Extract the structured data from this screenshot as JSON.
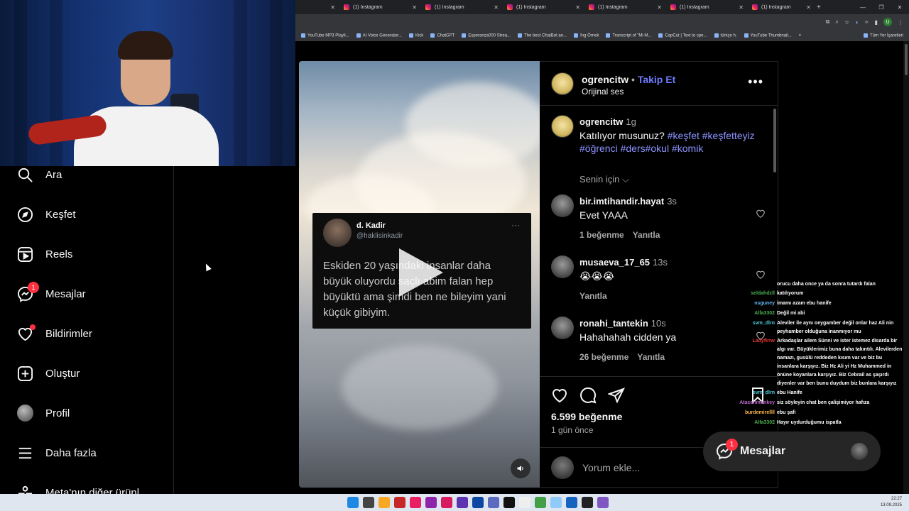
{
  "browser": {
    "tabs": [
      {
        "label": "(1) Instagram"
      },
      {
        "label": "(1) Instagram"
      },
      {
        "label": "(1) Instagram"
      },
      {
        "label": "(1) Instagram"
      },
      {
        "label": "(1) Instagram"
      },
      {
        "label": "(1) Instagram"
      }
    ],
    "bookmarks": [
      "YouTube MP3 Playli...",
      "AI Voice Generator...",
      "Kick",
      "ChatGPT",
      "Esperanza000 Strea...",
      "The best ChatBot an...",
      "İng Örnek",
      "Transcript of \"Mi M...",
      "CapCut | Text to spe...",
      "türkçe h.",
      "YouTube Thumbnail..."
    ],
    "all_bookmarks": "Tüm Yer İşaretleri",
    "profile_initial": "U"
  },
  "sidebar": {
    "items": [
      {
        "label": "Ara",
        "icon": "search-icon"
      },
      {
        "label": "Keşfet",
        "icon": "compass-icon"
      },
      {
        "label": "Reels",
        "icon": "reels-icon"
      },
      {
        "label": "Mesajlar",
        "icon": "messenger-icon",
        "badge": "1"
      },
      {
        "label": "Bildirimler",
        "icon": "heart-icon"
      },
      {
        "label": "Oluştur",
        "icon": "plus-square-icon"
      },
      {
        "label": "Profil",
        "icon": "avatar"
      },
      {
        "label": "Daha fazla",
        "icon": "menu-icon"
      },
      {
        "label": "Meta'nın diğer ürünl",
        "icon": "meta-icon"
      }
    ]
  },
  "reel": {
    "tweet_name": "d. Kadir",
    "tweet_handle": "@haklisinkadir",
    "tweet_text": "Eskiden 20 yaşındaki insanlar daha büyük oluyordu saçlı abim falan hep büyüktü ama şimdi ben ne bileyim yani küçük gibiyim."
  },
  "post": {
    "username": "ogrencitw",
    "follow": "Takip Et",
    "audio": "Orijinal ses",
    "caption_user": "ogrencitw",
    "caption_time": "1g",
    "caption_text": "Katılıyor musunuz?",
    "caption_tags": "#keşfet #keşfetteyiz #öğrenci #ders#okul #komik",
    "sort_label": "Senin için",
    "comments": [
      {
        "user": "bir.imtihandir.hayat",
        "time": "3s",
        "text": "Evet YAAA",
        "likes": "1 beğenme",
        "reply": "Yanıtla"
      },
      {
        "user": "musaeva_17_65",
        "time": "13s",
        "text": "😭😭😭",
        "likes": "",
        "reply": "Yanıtla"
      },
      {
        "user": "ronahi_tantekin",
        "time": "10s",
        "text": "Hahahahah cidden ya",
        "likes": "26 beğenme",
        "reply": "Yanıtla"
      }
    ],
    "like_count": "6.599 beğenme",
    "posted_ago": "1 gün önce",
    "comment_placeholder": "Yorum ekle..."
  },
  "chat": [
    {
      "user": "",
      "color": "#ffffff",
      "msg": "orucu daha once ya da sonra tutardı falan"
    },
    {
      "user": "seldahdzll",
      "color": "#4caf50",
      "msg": "katılıyorum"
    },
    {
      "user": "nsguney",
      "color": "#64b5f6",
      "msg": "imamı azam ebu hanife"
    },
    {
      "user": "Alfa3302",
      "color": "#4caf50",
      "msg": "Değil mi abi"
    },
    {
      "user": "svm_dlrn",
      "color": "#4dd0e1",
      "msg": "Aleviler ile aynı oeygamber değil onlar haz Ali nin peyhamber olduğuna inanmıyor mu"
    },
    {
      "user": "Ladyfirrw",
      "color": "#e53935",
      "msg": "Arkadaşlar ailem Sünni ve ister istemez disarda bir algı var. Büyüklerimiz buna daha takıntılı. Alevilerden namazı, gusülü reddeden kısım var ve biz bu insanlara karşıyız. Biz Hz Ali yi Hz Muhammed in önüne koyanlara karşıyız. Biz Cebrail as şaşırdı diyenler var ben bunu duydum biz bunlara karşıyız"
    },
    {
      "user": "svm_dlrn",
      "color": "#4dd0e1",
      "msg": "ebu Hanife"
    },
    {
      "user": "Atacanmonkey",
      "color": "#ba68c8",
      "msg": "siz söyleyin chat ben çalişimiyor hafıza"
    },
    {
      "user": "burdemirellll",
      "color": "#ffb74d",
      "msg": "ebu şafi"
    },
    {
      "user": "Alfa3302",
      "color": "#4caf50",
      "msg": "Hayır uydurduğumu ispatla"
    }
  ],
  "messages_float": {
    "label": "Mesajlar",
    "badge": "1"
  },
  "taskbar": {
    "time": "22:27",
    "date": "13.09.2025"
  }
}
